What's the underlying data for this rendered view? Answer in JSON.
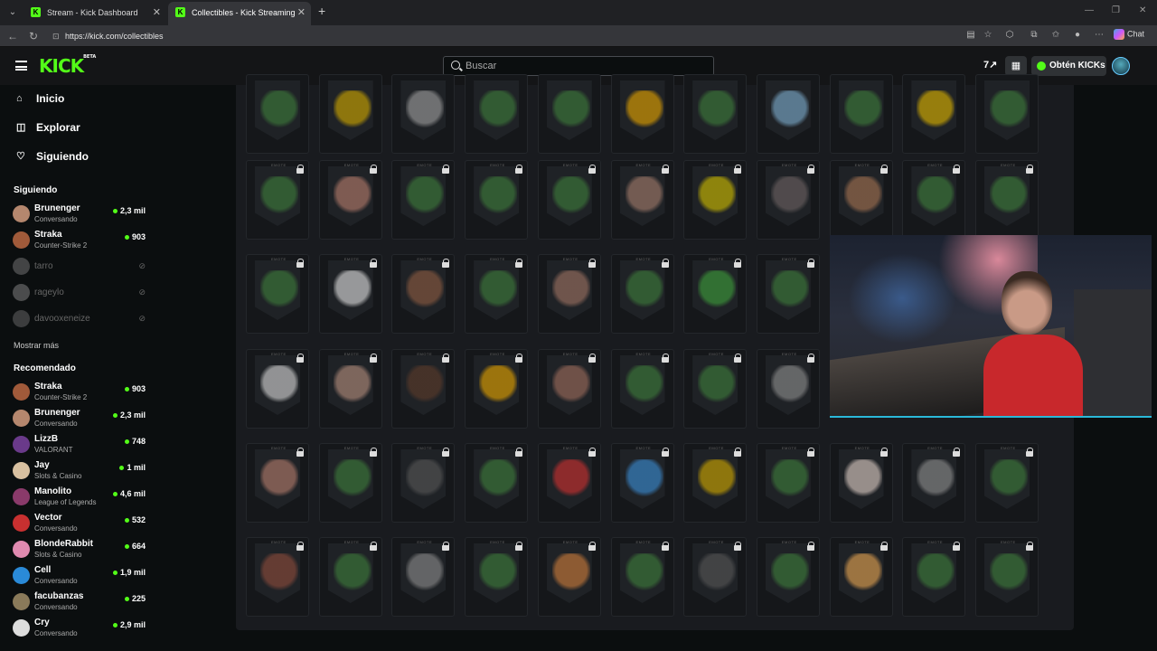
{
  "browser": {
    "tabs": [
      {
        "title": "Stream - Kick Dashboard",
        "favicon": "kick-icon",
        "active": false
      },
      {
        "title": "Collectibles - Kick Streaming",
        "favicon": "kick-icon",
        "active": true
      }
    ],
    "url": "https://kick.com/collectibles",
    "chat_label": "Chat"
  },
  "header": {
    "logo": "KICK",
    "logo_badge": "BETA",
    "search_placeholder": "Buscar",
    "kicks_label": "Obtén KICKs",
    "accent": "#53fc18"
  },
  "sidebar": {
    "nav": [
      {
        "label": "Inicio",
        "icon": "home-icon"
      },
      {
        "label": "Explorar",
        "icon": "explore-icon"
      },
      {
        "label": "Siguiendo",
        "icon": "heart-icon"
      }
    ],
    "following_title": "Siguiendo",
    "following": [
      {
        "name": "Brunenger",
        "category": "Conversando",
        "viewers": "2,3 mil",
        "live": true
      },
      {
        "name": "Straka",
        "category": "Counter-Strike 2",
        "viewers": "903",
        "live": true
      },
      {
        "name": "tarro",
        "live": false
      },
      {
        "name": "rageylo",
        "live": false
      },
      {
        "name": "davooxeneize",
        "live": false
      }
    ],
    "show_more": "Mostrar más",
    "recommended_title": "Recomendado",
    "recommended": [
      {
        "name": "Straka",
        "category": "Counter-Strike 2",
        "viewers": "903"
      },
      {
        "name": "Brunenger",
        "category": "Conversando",
        "viewers": "2,3 mil"
      },
      {
        "name": "LizzB",
        "category": "VALORANT",
        "viewers": "748"
      },
      {
        "name": "Jay",
        "category": "Slots & Casino",
        "viewers": "1 mil"
      },
      {
        "name": "Manolito",
        "category": "League of Legends",
        "viewers": "4,6 mil"
      },
      {
        "name": "Vector",
        "category": "Conversando",
        "viewers": "532"
      },
      {
        "name": "BlondeRabbit",
        "category": "Slots & Casino",
        "viewers": "664"
      },
      {
        "name": "Cell",
        "category": "Conversando",
        "viewers": "1,9 mil"
      },
      {
        "name": "facubanzas",
        "category": "Conversando",
        "viewers": "225"
      },
      {
        "name": "Cry",
        "category": "Conversando",
        "viewers": "2,9 mil"
      }
    ]
  },
  "collectibles": {
    "card_tag": "EMOTE",
    "emote_colors": [
      [
        "#3d7a3a",
        "#c9a300",
        "#9a9a9a",
        "#3d7a3a",
        "#3d7a3a",
        "#e0a000",
        "#3d7a3a",
        "#7aa8c8",
        "#3d7a3a",
        "#d8b000",
        "#3d7a3a"
      ],
      [
        "#3d7a3a",
        "#b27a6a",
        "#3d7a3a",
        "#3d7a3a",
        "#3d7a3a",
        "#a07a6a",
        "#c9b800",
        "#6a6060",
        "#a07050",
        "#3d7a3a",
        "#3d7a3a"
      ],
      [
        "#3d7a3a",
        "#d8d8d8",
        "#8a5a40",
        "#3d7a3a",
        "#9a7060",
        "#3d7a3a",
        "#3d9a3a",
        "#3d7a3a"
      ],
      [
        "#cfcfcf",
        "#b08a7a",
        "#5a3a2a",
        "#e0a000",
        "#9a6a5a",
        "#3d7a3a",
        "#3d7a3a",
        "#8a8a8a"
      ],
      [
        "#b07a6a",
        "#3d7a3a",
        "#555555",
        "#3d7a3a",
        "#c83030",
        "#3a8ad0",
        "#c9a300",
        "#3d7a3a",
        "#d8c8c0",
        "#8a8a8a",
        "#3d7a3a"
      ],
      [
        "#8a4a3a",
        "#3d7a3a",
        "#888888",
        "#3d7a3a",
        "#c87a3a",
        "#3d7a3a",
        "#555555",
        "#3d7a3a",
        "#e0a050",
        "#3d7a3a",
        "#3d7a3a"
      ]
    ]
  }
}
